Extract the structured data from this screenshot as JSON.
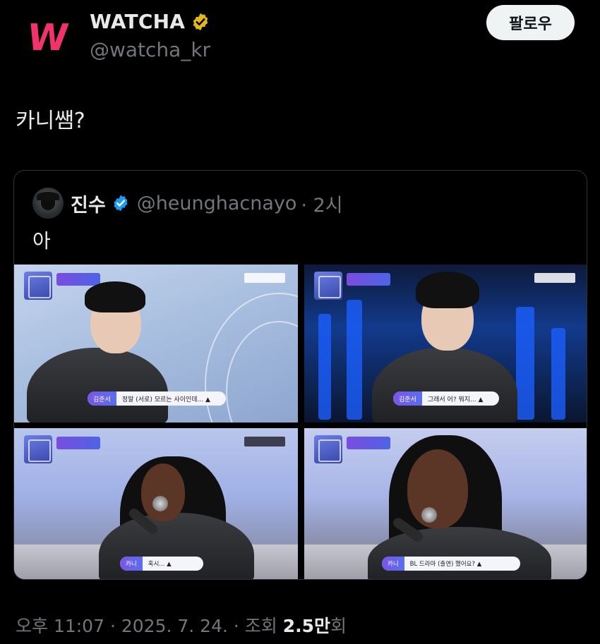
{
  "author": {
    "display_name": "WATCHA",
    "handle": "@watcha_kr",
    "avatar_letter": "W",
    "avatar_color": "#f0336b",
    "verified_color": "#e2b719"
  },
  "follow_button": {
    "label": "팔로우"
  },
  "tweet": {
    "text": "카니쌤?"
  },
  "quoted": {
    "display_name": "진수",
    "handle": "@heunghacnayo",
    "time": "· 2시",
    "text": "아",
    "verified_color": "#1d9bf0",
    "frames": [
      {
        "caption_name": "김준서",
        "caption_text": "정말 (서로) 모르는 사이인데... ▲"
      },
      {
        "caption_name": "김준서",
        "caption_text": "그래서 어? 뭐지... ▲"
      },
      {
        "caption_name": "카니",
        "caption_text": "혹시... ▲"
      },
      {
        "caption_name": "카니",
        "caption_text": "BL 드라마 (출연) 했어요? ▲"
      }
    ]
  },
  "footer": {
    "time": "오후 11:07",
    "date": "· 2025. 7. 24.",
    "views_prefix": "· 조회",
    "views_value": "2.5만",
    "views_suffix": "회"
  }
}
